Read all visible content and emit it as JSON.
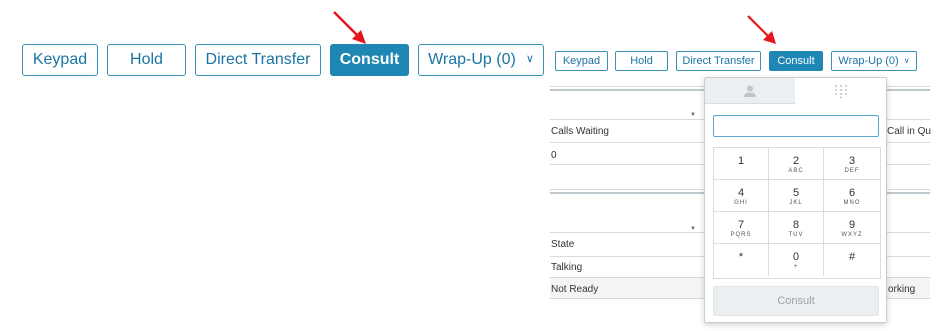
{
  "left_toolbar": {
    "keypad": "Keypad",
    "hold": "Hold",
    "direct_transfer": "Direct Transfer",
    "consult": "Consult",
    "wrapup": "Wrap-Up (0)"
  },
  "right_toolbar": {
    "keypad": "Keypad",
    "hold": "Hold",
    "direct_transfer": "Direct Transfer",
    "consult": "Consult",
    "wrapup": "Wrap-Up (0)"
  },
  "queue_table": {
    "col1_header": "Calls Waiting",
    "col2_header": "Call in Qu",
    "col1_value": "0"
  },
  "agent_table": {
    "col1_header": "State",
    "rows": [
      "Talking",
      "Not Ready"
    ],
    "right_fragment": "orking"
  },
  "dialpad": {
    "input_value": "",
    "input_placeholder": "",
    "keys": [
      {
        "digit": "1",
        "letters": ""
      },
      {
        "digit": "2",
        "letters": "ABC"
      },
      {
        "digit": "3",
        "letters": "DEF"
      },
      {
        "digit": "4",
        "letters": "GHI"
      },
      {
        "digit": "5",
        "letters": "JKL"
      },
      {
        "digit": "6",
        "letters": "MNO"
      },
      {
        "digit": "7",
        "letters": "PQRS"
      },
      {
        "digit": "8",
        "letters": "TUV"
      },
      {
        "digit": "9",
        "letters": "WXYZ"
      },
      {
        "digit": "*",
        "letters": ""
      },
      {
        "digit": "0",
        "letters": "+"
      },
      {
        "digit": "#",
        "letters": ""
      }
    ],
    "submit_label": "Consult"
  },
  "icons": {
    "wrapup_dropdown": "chevron-down-icon",
    "contacts_tab": "person-icon",
    "keypad_tab": "dialpad-grid-icon",
    "annotation": "red-arrow-icon"
  },
  "colors": {
    "accent": "#1e87b4",
    "annotation_arrow": "#e8141b",
    "disabled_bg": "#eceff1"
  }
}
